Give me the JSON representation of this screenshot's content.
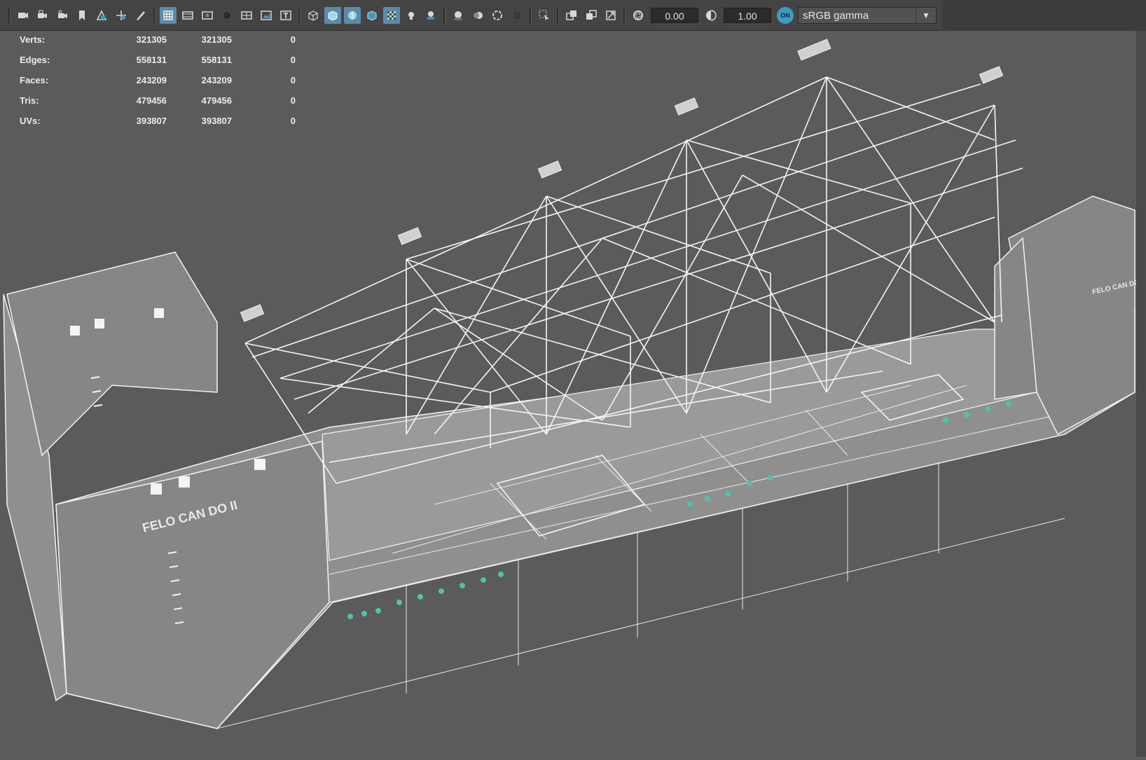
{
  "toolbar": {
    "icons": [
      "camera-icon",
      "camera-lock-icon",
      "camera-attributes-icon",
      "bookmark-icon",
      "image-plane-icon",
      "2d-pan-zoom-icon",
      "grease-pencil-icon",
      "grid-icon",
      "film-gate-icon",
      "resolution-gate-icon",
      "gate-mask-icon",
      "field-chart-icon",
      "safe-action-icon",
      "safe-title-icon",
      "wireframe-icon",
      "smooth-shade-icon",
      "wireframe-on-shaded-icon",
      "default-material-icon",
      "xray-icon",
      "use-lights-icon",
      "shadows-icon",
      "ambient-occlusion-icon",
      "motion-blur-icon",
      "anti-aliasing-icon",
      "depth-of-field-icon",
      "isolate-select-icon",
      "xray-joints-icon",
      "xray-active-icon",
      "backface-culling-icon",
      "exposure-icon",
      "gamma-icon"
    ],
    "exposure_value": "0.00",
    "gamma_value": "1.00",
    "color_management_toggle": "ON",
    "view_transform": "sRGB gamma"
  },
  "hud": {
    "rows": [
      {
        "label": "Verts:",
        "v1": "321305",
        "v2": "321305",
        "v3": "0"
      },
      {
        "label": "Edges:",
        "v1": "558131",
        "v2": "558131",
        "v3": "0"
      },
      {
        "label": "Faces:",
        "v1": "243209",
        "v2": "243209",
        "v3": "0"
      },
      {
        "label": "Tris:",
        "v1": "479456",
        "v2": "479456",
        "v3": "0"
      },
      {
        "label": "UVs:",
        "v1": "393807",
        "v2": "393807",
        "v3": "0"
      }
    ]
  },
  "model": {
    "hull_name_text": "FELO CAN DO II",
    "hull_name_small": "FELO CAN DO II",
    "colors": {
      "background": "#5b5b5b",
      "wireframe": "#f4f4f4",
      "hull_fill": "#8f8f8f",
      "accent_teal": "#4fc1b0"
    }
  }
}
